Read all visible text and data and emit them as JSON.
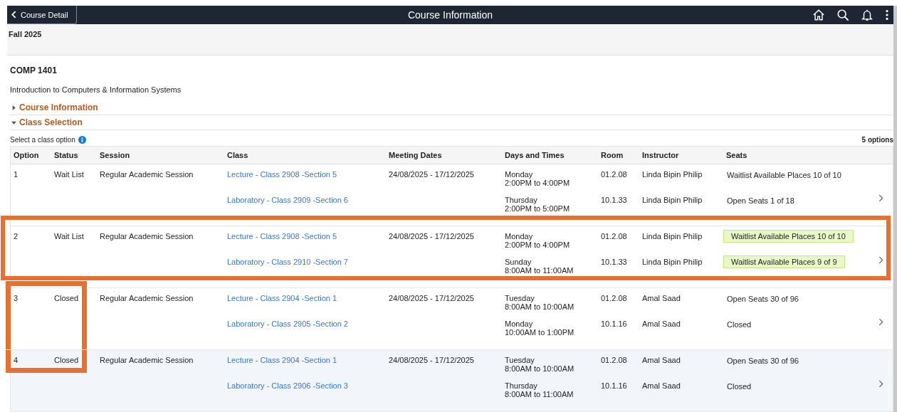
{
  "top_bar": {
    "back_button": "Course Detail",
    "title": "Course Information"
  },
  "term": "Fall 2025",
  "course": {
    "code": "COMP 1401",
    "name": "Introduction to Computers & Information Systems"
  },
  "sections": [
    {
      "label": "Course Information",
      "expanded": false
    },
    {
      "label": "Class Selection",
      "expanded": true
    }
  ],
  "class_options": {
    "prompt": "Select a class option",
    "count": "5 options",
    "columns": [
      "Option",
      "Status",
      "Session",
      "Class",
      "Meeting Dates",
      "Days and Times",
      "Room",
      "Instructor",
      "Seats"
    ],
    "rows": [
      {
        "option": "1",
        "status": "Wait List",
        "session": "Regular Academic Session",
        "meeting_dates": "24/08/2025 - 17/12/2025",
        "selected": false,
        "frame": false,
        "status_frame": false,
        "classes": [
          {
            "class": "Lecture - Class 2908 -Section 5",
            "day": "Monday",
            "time": "2:00PM to 4:00PM",
            "room": "01.2.08",
            "instructor": "Linda Bipin Philip",
            "seats": "Waitlist Available Places 10 of 10",
            "highlighted": false
          },
          {
            "class": "Laboratory - Class 2909 -Section 6",
            "day": "Thursday",
            "time": "2:00PM to 5:00PM",
            "room": "10.1.33",
            "instructor": "Linda Bipin Philip",
            "seats": "Open Seats 1 of 18",
            "highlighted": false
          }
        ]
      },
      {
        "option": "2",
        "status": "Wait List",
        "session": "Regular Academic Session",
        "meeting_dates": "24/08/2025 - 17/12/2025",
        "selected": false,
        "frame": true,
        "status_frame": false,
        "classes": [
          {
            "class": "Lecture - Class 2908 -Section 5",
            "day": "Monday",
            "time": "2:00PM to 4:00PM",
            "room": "01.2.08",
            "instructor": "Linda Bipin Philip",
            "seats": "Waitlist Available Places 10 of 10",
            "highlighted": true
          },
          {
            "class": "Laboratory - Class 2910 -Section 7",
            "day": "Sunday",
            "time": "8:00AM to 11:00AM",
            "room": "10.1.33",
            "instructor": "Linda Bipin Philip",
            "seats": "Waitlist Available Places 9 of 9",
            "highlighted": true
          }
        ]
      },
      {
        "option": "3",
        "status": "Closed",
        "session": "Regular Academic Session",
        "meeting_dates": "24/08/2025 - 17/12/2025",
        "selected": false,
        "frame": false,
        "status_frame": true,
        "classes": [
          {
            "class": "Lecture - Class 2904 -Section 1",
            "day": "Tuesday",
            "time": "8:00AM to 10:00AM",
            "room": "01.2.08",
            "instructor": "Amal Saad",
            "seats": "Open Seats 30 of 96",
            "highlighted": false
          },
          {
            "class": "Laboratory - Class 2905 -Section 2",
            "day": "Monday",
            "time": "10:00AM to 1:00PM",
            "room": "10.1.16",
            "instructor": "Amal Saad",
            "seats": "Closed",
            "highlighted": false
          }
        ]
      },
      {
        "option": "4",
        "status": "Closed",
        "session": "Regular Academic Session",
        "meeting_dates": "24/08/2025 - 17/12/2025",
        "selected": true,
        "frame": false,
        "status_frame": true,
        "classes": [
          {
            "class": "Lecture - Class 2904 -Section 1",
            "day": "Tuesday",
            "time": "8:00AM to 10:00AM",
            "room": "01.2.08",
            "instructor": "Amal Saad",
            "seats": "Open Seats 30 of 96",
            "highlighted": false
          },
          {
            "class": "Laboratory - Class 2906 -Section 3",
            "day": "Thursday",
            "time": "8:00AM to 11:00AM",
            "room": "10.1.16",
            "instructor": "Amal Saad",
            "seats": "Closed",
            "highlighted": false
          }
        ]
      }
    ]
  }
}
